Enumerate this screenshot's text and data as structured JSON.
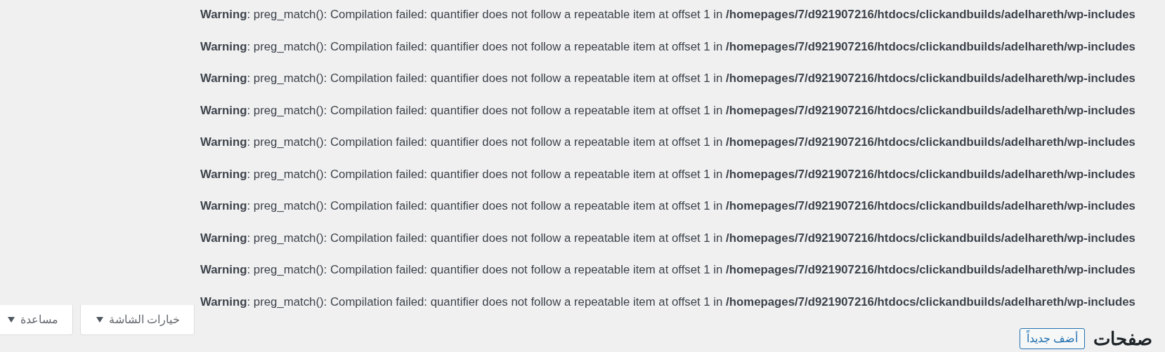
{
  "warnings": [
    "**Warning**: preg_match(): Compilation failed: quantifier does not follow a repeatable item at offset 1 in **/homepages/7/d921907216/htdocs/clickandbuilds/adelhareth/wp-includes**",
    "**Warning**: preg_match(): Compilation failed: quantifier does not follow a repeatable item at offset 1 in **/homepages/7/d921907216/htdocs/clickandbuilds/adelhareth/wp-includes**",
    "**Warning**: preg_match(): Compilation failed: quantifier does not follow a repeatable item at offset 1 in **/homepages/7/d921907216/htdocs/clickandbuilds/adelhareth/wp-includes**",
    "**Warning**: preg_match(): Compilation failed: quantifier does not follow a repeatable item at offset 1 in **/homepages/7/d921907216/htdocs/clickandbuilds/adelhareth/wp-includes**",
    "**Warning**: preg_match(): Compilation failed: quantifier does not follow a repeatable item at offset 1 in **/homepages/7/d921907216/htdocs/clickandbuilds/adelhareth/wp-includes**",
    "**Warning**: preg_match(): Compilation failed: quantifier does not follow a repeatable item at offset 1 in **/homepages/7/d921907216/htdocs/clickandbuilds/adelhareth/wp-includes**",
    "**Warning**: preg_match(): Compilation failed: quantifier does not follow a repeatable item at offset 1 in **/homepages/7/d921907216/htdocs/clickandbuilds/adelhareth/wp-includes**",
    "**Warning**: preg_match(): Compilation failed: quantifier does not follow a repeatable item at offset 1 in **/homepages/7/d921907216/htdocs/clickandbuilds/adelhareth/wp-includes**",
    "**Warning**: preg_match(): Compilation failed: quantifier does not follow a repeatable item at offset 1 in **/homepages/7/d921907216/htdocs/clickandbuilds/adelhareth/wp-includes**",
    "**Warning**: preg_match(): Compilation failed: quantifier does not follow a repeatable item at offset 1 in **/homepages/7/d921907216/htdocs/clickandbuilds/adelhareth/wp-includes**"
  ],
  "screen_meta_buttons": [
    "خيارات الشاشة",
    "مساعدة"
  ],
  "page_title": "صفحات",
  "add_new_button": "أضف جديداً"
}
